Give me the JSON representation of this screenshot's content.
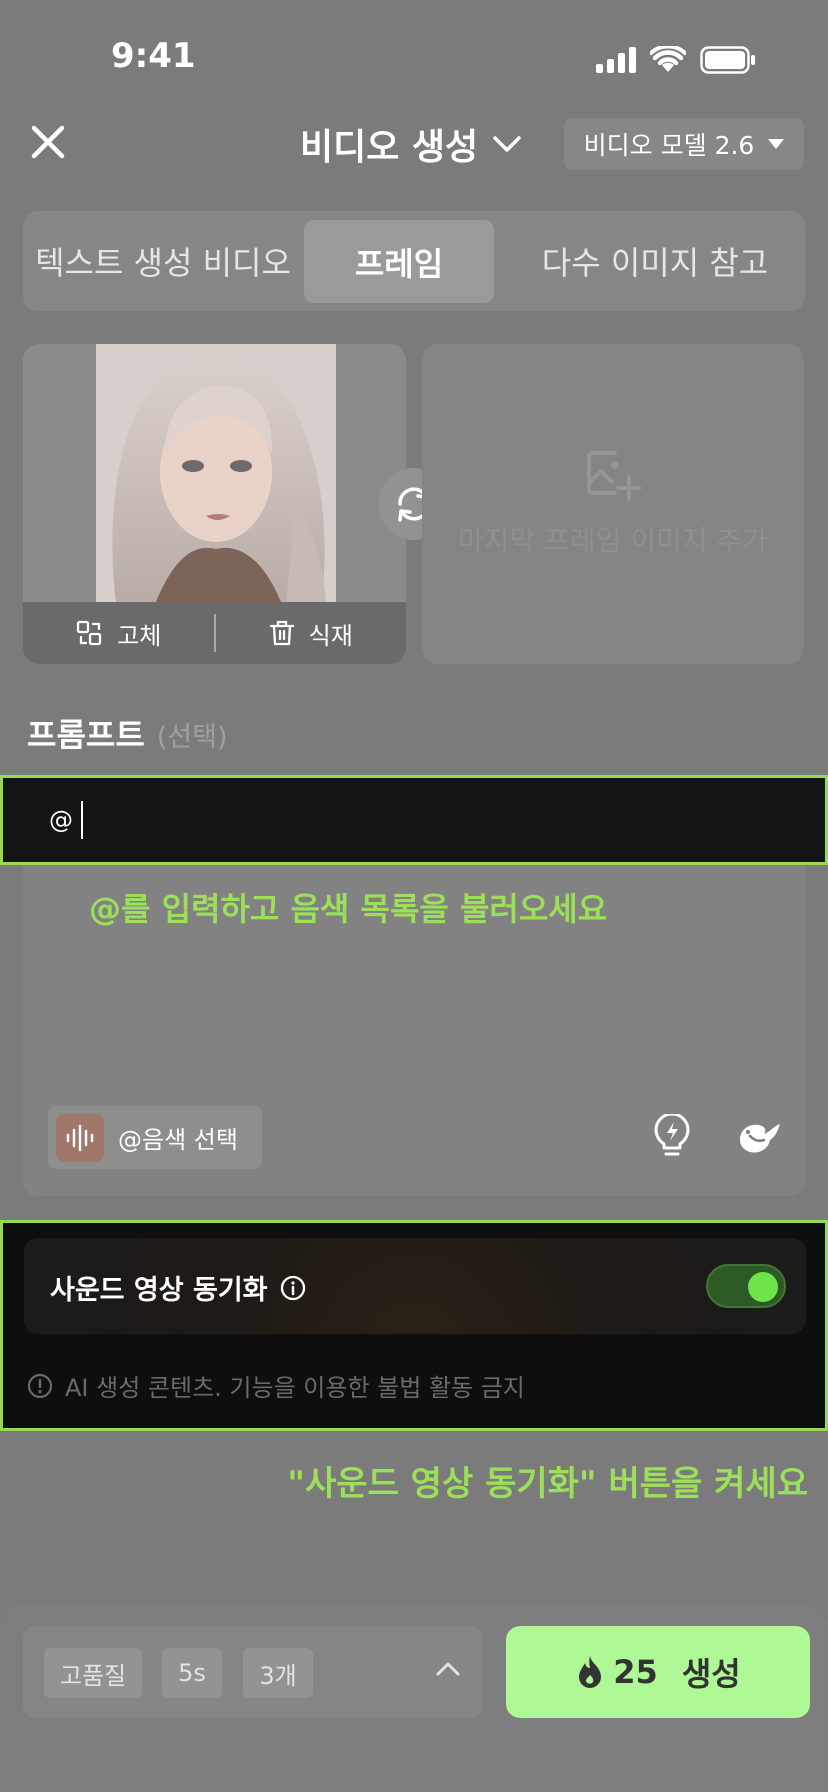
{
  "status_bar": {
    "time": "9:41"
  },
  "header": {
    "title": "비디오 생성",
    "model_label": "비디오 모델 2.6"
  },
  "tabs": [
    {
      "label": "텍스트 생성 비디오"
    },
    {
      "label": "프레임",
      "active": true
    },
    {
      "label": "다수 이미지 참고"
    }
  ],
  "frames": {
    "first": {
      "replace_label": "고체",
      "delete_label": "식재"
    },
    "last": {
      "add_label": "마지막 프레임 이미지 추가"
    }
  },
  "prompt": {
    "heading": "프롬프트",
    "optional": "(선택)",
    "value": "@",
    "voice_button": "@음색 선택"
  },
  "hints": {
    "type_at": "@를 입력하고 음색 목록을 불러오세요",
    "turn_on_sync": "\"사운드 영상 동기화\" 버튼을 켜세요"
  },
  "sync": {
    "label": "사운드 영상 동기화",
    "enabled": true,
    "disclaimer": "AI 생성 콘텐츠. 기능을 이용한 불법 활동 금지"
  },
  "footer": {
    "quality": "고품질",
    "duration": "5s",
    "count": "3개",
    "credits": "25",
    "generate_label": "생성"
  },
  "colors": {
    "accent_green": "#97da52",
    "generate_bg": "#aef896",
    "toggle_on": "#6fe34a"
  }
}
